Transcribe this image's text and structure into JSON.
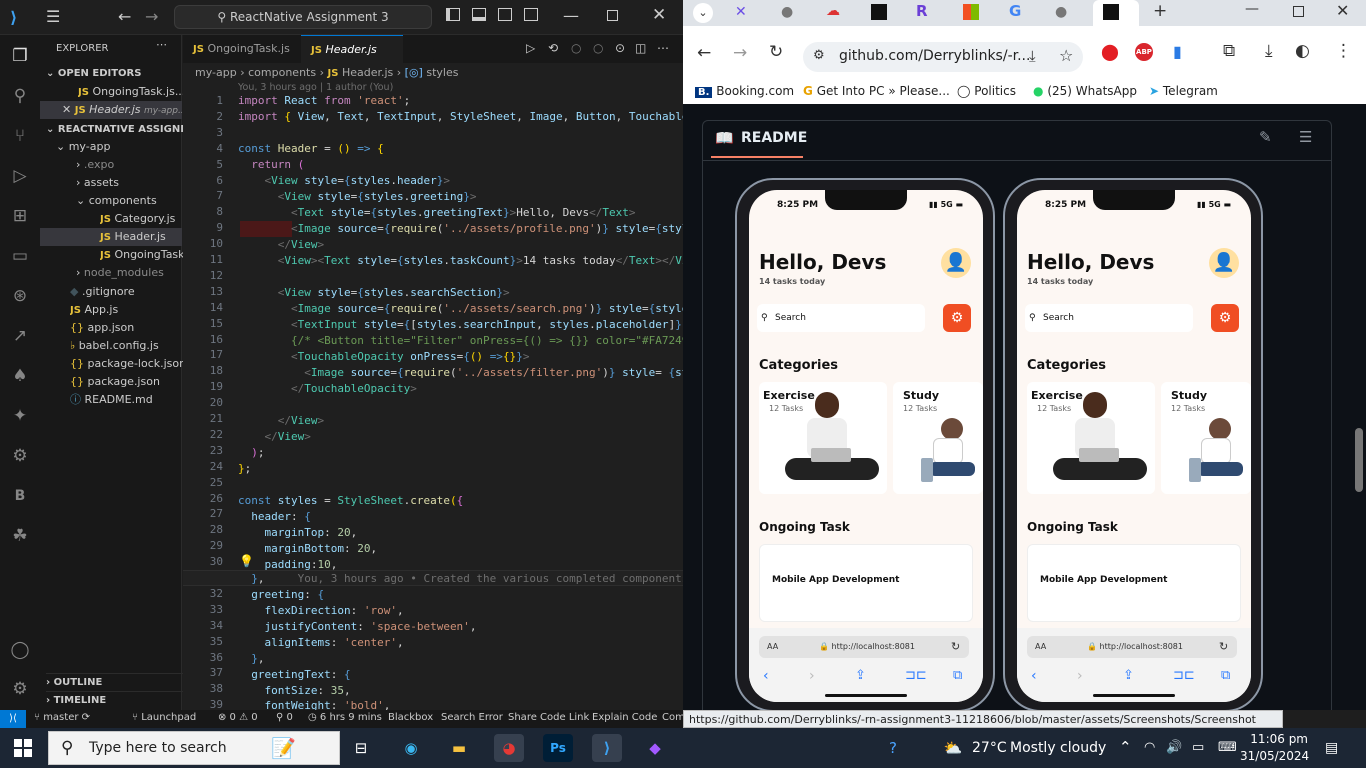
{
  "vscode": {
    "command_center": "ReactNative Assignment 3",
    "explorer_title": "EXPLORER",
    "open_editors": "OPEN EDITORS",
    "open_files": [
      "OngoingTask.js...",
      "Header.js"
    ],
    "open_files_path": "my-app...",
    "project": "REACTNATIVE ASSIGNME...",
    "tree": [
      "my-app",
      ".expo",
      "assets",
      "components",
      "Category.js",
      "Header.js",
      "OngoingTask.js",
      "node_modules",
      ".gitignore",
      "App.js",
      "app.json",
      "babel.config.js",
      "package-lock.json",
      "package.json",
      "README.md"
    ],
    "outline": "OUTLINE",
    "timeline": "TIMELINE",
    "tabs": [
      "OngoingTask.js",
      "Header.js"
    ],
    "breadcrumb": [
      "my-app",
      "components",
      "Header.js",
      "styles"
    ],
    "blame": "You, 3 hours ago | 1 author (You)",
    "line_numbers": [
      "1",
      "2",
      "3",
      "4",
      "5",
      "6",
      "7",
      "8",
      "9",
      "10",
      "11",
      "12",
      "13",
      "14",
      "15",
      "16",
      "17",
      "18",
      "19",
      "20",
      "21",
      "22",
      "23",
      "24",
      "25",
      "26",
      "27",
      "28",
      "29",
      "30",
      "31",
      "32",
      "33",
      "34",
      "35",
      "36",
      "37",
      "38",
      "39"
    ],
    "inline_blame": "You, 3 hours ago • Created the various completed components",
    "status": {
      "branch": "master",
      "launchpad": "Launchpad",
      "problems": "⊗ 0 ⚠ 0",
      "ports": "0",
      "time": "6 hrs 9 mins",
      "items": [
        "Blackbox",
        "Search Error",
        "Share Code Link",
        "Explain Code",
        "Com"
      ]
    }
  },
  "chrome": {
    "url": "github.com/Derryblinks/-r...",
    "bookmarks": [
      "Booking.com",
      "Get Into PC » Please...",
      "Politics",
      "(25) WhatsApp",
      "Telegram"
    ],
    "readme_title": "README",
    "status_url": "https://github.com/Derryblinks/-rn-assignment3-11218606/blob/master/assets/Screenshots/Screenshot 2.png"
  },
  "phone": {
    "time": "8:25 PM",
    "signal": "5G",
    "greeting": "Hello, Devs",
    "tasks_today": "14 tasks today",
    "search_placeholder": "Search",
    "categories_title": "Categories",
    "category1": "Exercise",
    "category1_count": "12 Tasks",
    "category2": "Study",
    "category2_count": "12 Tasks",
    "ongoing_title": "Ongoing Task",
    "ongoing1": "Mobile App Development",
    "browser_aa": "AA",
    "browser_url": "http://localhost:8081"
  },
  "taskbar": {
    "search_placeholder": "Type here to search",
    "temperature": "27°C",
    "weather": "Mostly cloudy",
    "time": "11:06 pm",
    "date": "31/05/2024"
  }
}
